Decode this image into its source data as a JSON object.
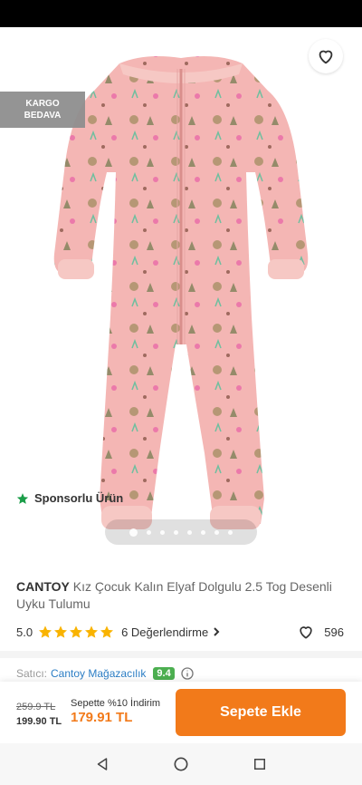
{
  "hero": {
    "badge_line1": "KARGO",
    "badge_line2": "BEDAVA",
    "sponsored": "Sponsorlu Ürün",
    "image_count": 8,
    "active_image_index": 0
  },
  "product": {
    "brand": "CANTOY",
    "name": "Kız Çocuk Kalın Elyaf Dolgulu 2.5 Tog Desenli Uyku Tulumu",
    "rating": "5.0",
    "stars": 5,
    "reviews_label": "6 Değerlendirme",
    "favorites": "596"
  },
  "seller": {
    "label": "Satıcı:",
    "name": "Cantoy Mağazacılık",
    "score": "9.4"
  },
  "purchase": {
    "old_price": "259.9 TL",
    "price": "199.90 TL",
    "promo_text": "Sepette %10 İndirim",
    "promo_price": "179.91 TL",
    "add_to_cart": "Sepete Ekle"
  },
  "icons": {
    "back": "arrow-left-icon",
    "share": "share-icon",
    "favorite": "heart-outline-icon",
    "star": "star-icon",
    "chevron": "chevron-right-icon",
    "info": "info-icon",
    "nav_back": "triangle-back-icon",
    "nav_home": "circle-home-icon",
    "nav_recent": "square-recent-icon"
  },
  "colors": {
    "accent": "#f27a1a",
    "star": "#f9b300",
    "link": "#2b7dc4",
    "score_badge": "#4caf50",
    "sponsor_star": "#1a9d48",
    "product_pink": "#f4b6b4"
  }
}
